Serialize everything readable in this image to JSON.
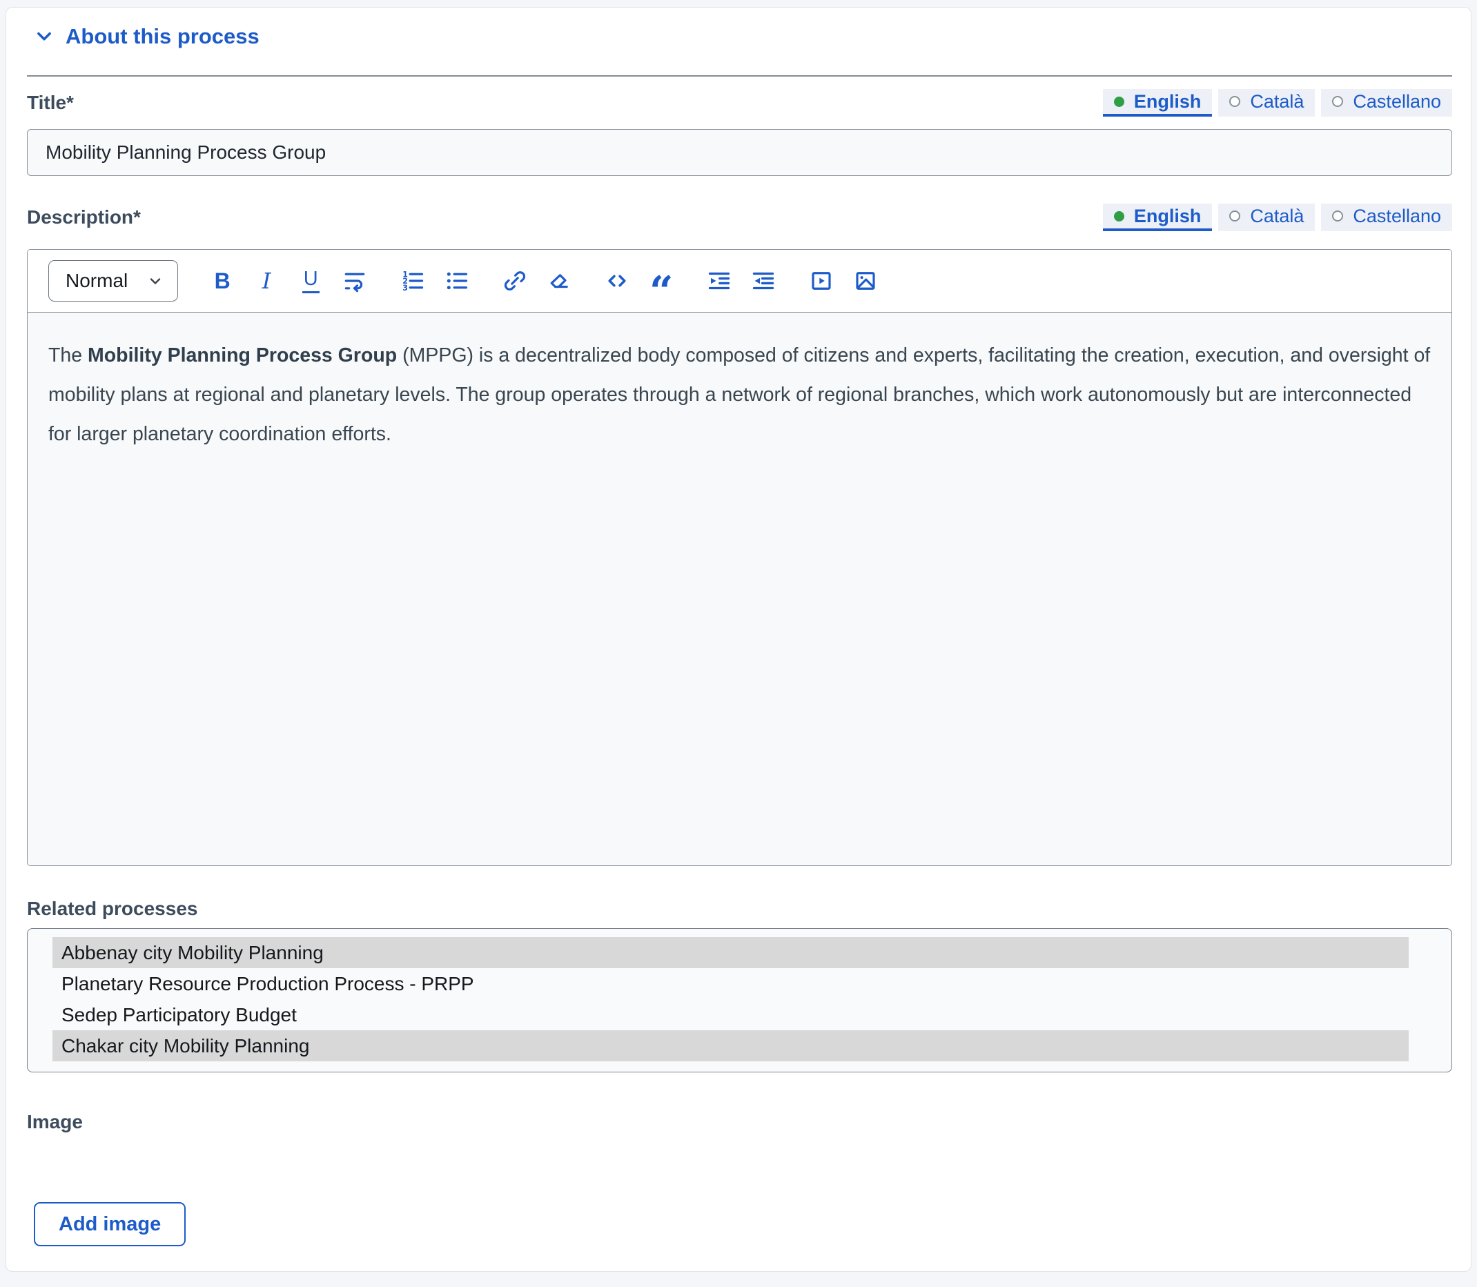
{
  "accordion": {
    "title": "About this process"
  },
  "language_tabs": {
    "options": [
      {
        "label": "English",
        "selected": true
      },
      {
        "label": "Català",
        "selected": false
      },
      {
        "label": "Castellano",
        "selected": false
      }
    ]
  },
  "title_field": {
    "label": "Title*",
    "value": "Mobility Planning Process Group"
  },
  "description_field": {
    "label": "Description*"
  },
  "editor": {
    "toolbar": {
      "paragraph_style": "Normal",
      "bold_glyph": "B",
      "italic_glyph": "I",
      "underline_glyph": "U",
      "quote_glyph": "“",
      "icons": [
        "bold",
        "italic",
        "underline",
        "text-wrap",
        "ordered-list",
        "bullet-list",
        "link",
        "clear-format",
        "code",
        "blockquote",
        "indent",
        "outdent",
        "video",
        "image"
      ]
    },
    "content": {
      "text_before_bold": "The ",
      "bold_text": "Mobility Planning Process Group",
      "text_after_bold": " (MPPG) is a decentralized body composed of citizens and experts, facilitating the creation, execution, and oversight of mobility plans at regional and planetary levels. The group operates through a network of regional branches, which work autonomously but are interconnected for larger planetary coordination efforts."
    }
  },
  "related_processes": {
    "label": "Related processes",
    "options": [
      {
        "label": "Abbenay city Mobility Planning",
        "selected": true
      },
      {
        "label": "Planetary Resource Production Process - PRPP",
        "selected": false
      },
      {
        "label": "Sedep Participatory Budget",
        "selected": false
      },
      {
        "label": "Chakar city Mobility Planning",
        "selected": true
      }
    ]
  },
  "image_field": {
    "label": "Image",
    "button_label": "Add image"
  },
  "colors": {
    "accent": "#1d5bc9",
    "active_language_dot": "#2f9e44",
    "selected_option_bg": "#d8d8d8"
  }
}
